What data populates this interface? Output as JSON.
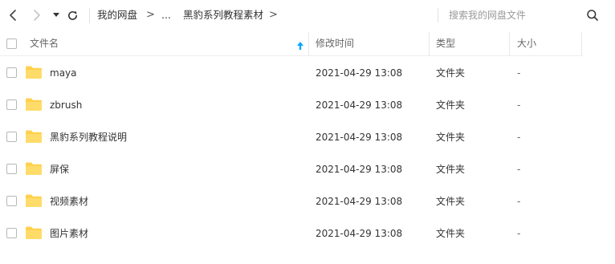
{
  "toolbar": {
    "breadcrumb": {
      "root": "我的网盘",
      "sep1": ">",
      "ellipsis": "...",
      "current": "黑豹系列教程素材",
      "sep2": ">"
    },
    "search_placeholder": "搜索我的网盘文件"
  },
  "table": {
    "columns": {
      "name": "文件名",
      "modified": "修改时间",
      "type": "类型",
      "size": "大小"
    },
    "rows": [
      {
        "name": "maya",
        "modified": "2021-04-29 13:08",
        "type": "文件夹",
        "size": "-"
      },
      {
        "name": "zbrush",
        "modified": "2021-04-29 13:08",
        "type": "文件夹",
        "size": "-"
      },
      {
        "name": "黑豹系列教程说明",
        "modified": "2021-04-29 13:08",
        "type": "文件夹",
        "size": "-"
      },
      {
        "name": "屏保",
        "modified": "2021-04-29 13:08",
        "type": "文件夹",
        "size": "-"
      },
      {
        "name": "视频素材",
        "modified": "2021-04-29 13:08",
        "type": "文件夹",
        "size": "-"
      },
      {
        "name": "图片素材",
        "modified": "2021-04-29 13:08",
        "type": "文件夹",
        "size": "-"
      }
    ]
  },
  "colors": {
    "folder": "#FFD14D",
    "accent": "#06a7ff"
  }
}
